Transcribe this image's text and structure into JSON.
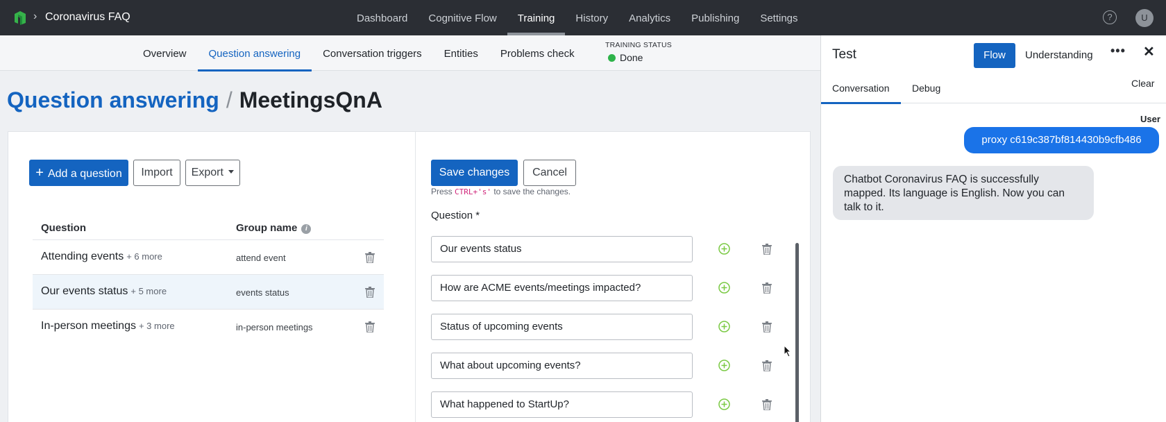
{
  "app": {
    "title": "Coronavirus FAQ",
    "breadcrumb_separator": "›"
  },
  "mainnav": [
    {
      "label": "Dashboard"
    },
    {
      "label": "Cognitive Flow"
    },
    {
      "label": "Training",
      "active": true
    },
    {
      "label": "History"
    },
    {
      "label": "Analytics"
    },
    {
      "label": "Publishing"
    },
    {
      "label": "Settings"
    }
  ],
  "header": {
    "help": "?",
    "avatar_initial": "U"
  },
  "subnav": [
    {
      "label": "Overview"
    },
    {
      "label": "Question answering",
      "active": true
    },
    {
      "label": "Conversation triggers"
    },
    {
      "label": "Entities"
    },
    {
      "label": "Problems check"
    }
  ],
  "training_status": {
    "label": "TRAINING STATUS",
    "value": "Done",
    "color": "#2eb34a"
  },
  "page": {
    "section": "Question answering",
    "separator": "/",
    "current": "MeetingsQnA"
  },
  "left_toolbar": {
    "add": "Add a question",
    "add_icon": "+",
    "import": "Import",
    "export": "Export"
  },
  "table": {
    "col_question": "Question",
    "col_group": "Group name",
    "rows": [
      {
        "question": "Attending events",
        "more": "+ 6 more",
        "group": "attend event"
      },
      {
        "question": "Our events status",
        "more": "+ 5 more",
        "group": "events status"
      },
      {
        "question": "In-person meetings",
        "more": "+ 3 more",
        "group": "in-person meetings"
      }
    ]
  },
  "editor": {
    "save": "Save changes",
    "cancel": "Cancel",
    "hint_before": "Press ",
    "hint_code": "CTRL+'s'",
    "hint_after": " to save the changes.",
    "question_label": "Question *",
    "questions": [
      "Our events status",
      "How are ACME events/meetings impacted?",
      "Status of upcoming events",
      "What about upcoming events?",
      "What happened to StartUp?"
    ]
  },
  "test_panel": {
    "title": "Test",
    "flow": "Flow",
    "understanding": "Understanding",
    "more": "•••",
    "close": "✕",
    "tab_conversation": "Conversation",
    "tab_debug": "Debug",
    "clear": "Clear",
    "user_label": "User",
    "user_message": "proxy c619c387bf814430b9cfb486",
    "bot_message": "Chatbot Coronavirus FAQ is successfully mapped. Its language is English. Now you can talk to it."
  },
  "colors": {
    "accent": "#1464c0",
    "topbar": "#2b2e34",
    "success": "#2eb34a",
    "add_icon": "#7ac943"
  }
}
